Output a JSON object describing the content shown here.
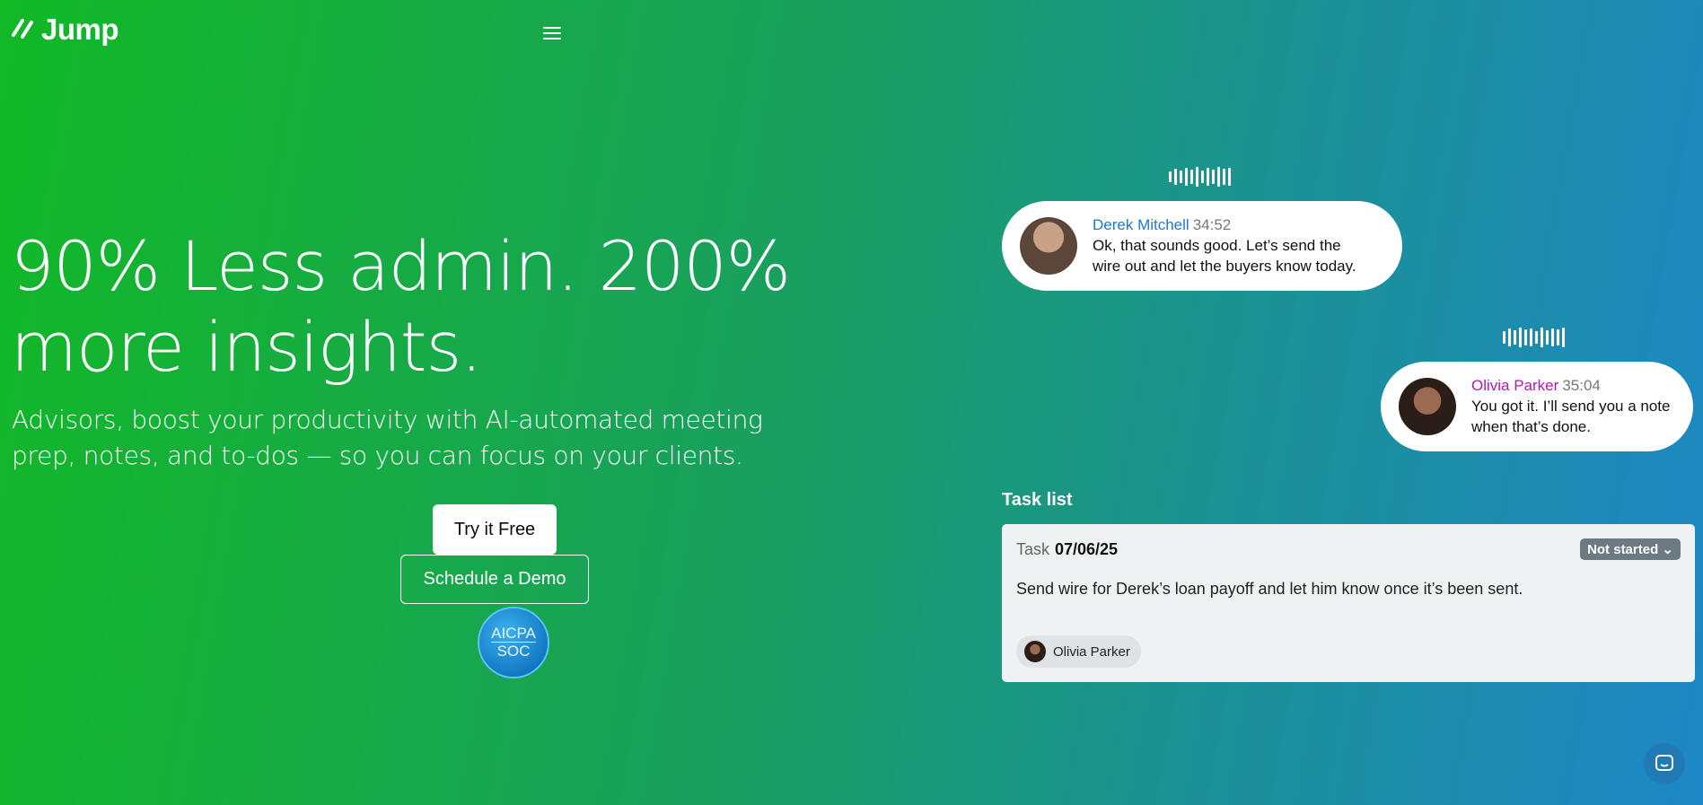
{
  "brand": {
    "name": "Jump",
    "logo_icon": "double-slash-icon"
  },
  "nav": {
    "menu_icon": "hamburger-menu-icon"
  },
  "hero": {
    "title": "90% Less admin. 200% more insights.",
    "subtitle": "Advisors, boost your productivity with AI-automated meeting prep, notes, and to-dos — so you can focus on your clients."
  },
  "cta": {
    "primary": "Try it Free",
    "secondary": "Schedule a Demo",
    "badge_line1": "AICPA",
    "badge_line2": "SOC"
  },
  "conversation": [
    {
      "speaker": "Derek Mitchell",
      "timestamp": "34:52",
      "message": "Ok, that sounds good. Let’s send the wire out and let the buyers know today.",
      "color": "#1a7ad0"
    },
    {
      "speaker": "Olivia Parker",
      "timestamp": "35:04",
      "message": "You got it. I’ll send you a note when that’s done.",
      "color": "#b019b0"
    }
  ],
  "tasks": {
    "heading": "Task list",
    "label": "Task",
    "date": "07/06/25",
    "status": "Not started",
    "description": "Send wire for Derek’s loan payoff and let him know once it’s been sent.",
    "assignee": "Olivia Parker"
  },
  "colors": {
    "gradient_start": "#12b826",
    "gradient_end": "#1c88c6",
    "status_badge": "#6c7a82"
  },
  "chat_widget": {
    "icon": "chat-bubble-icon"
  }
}
